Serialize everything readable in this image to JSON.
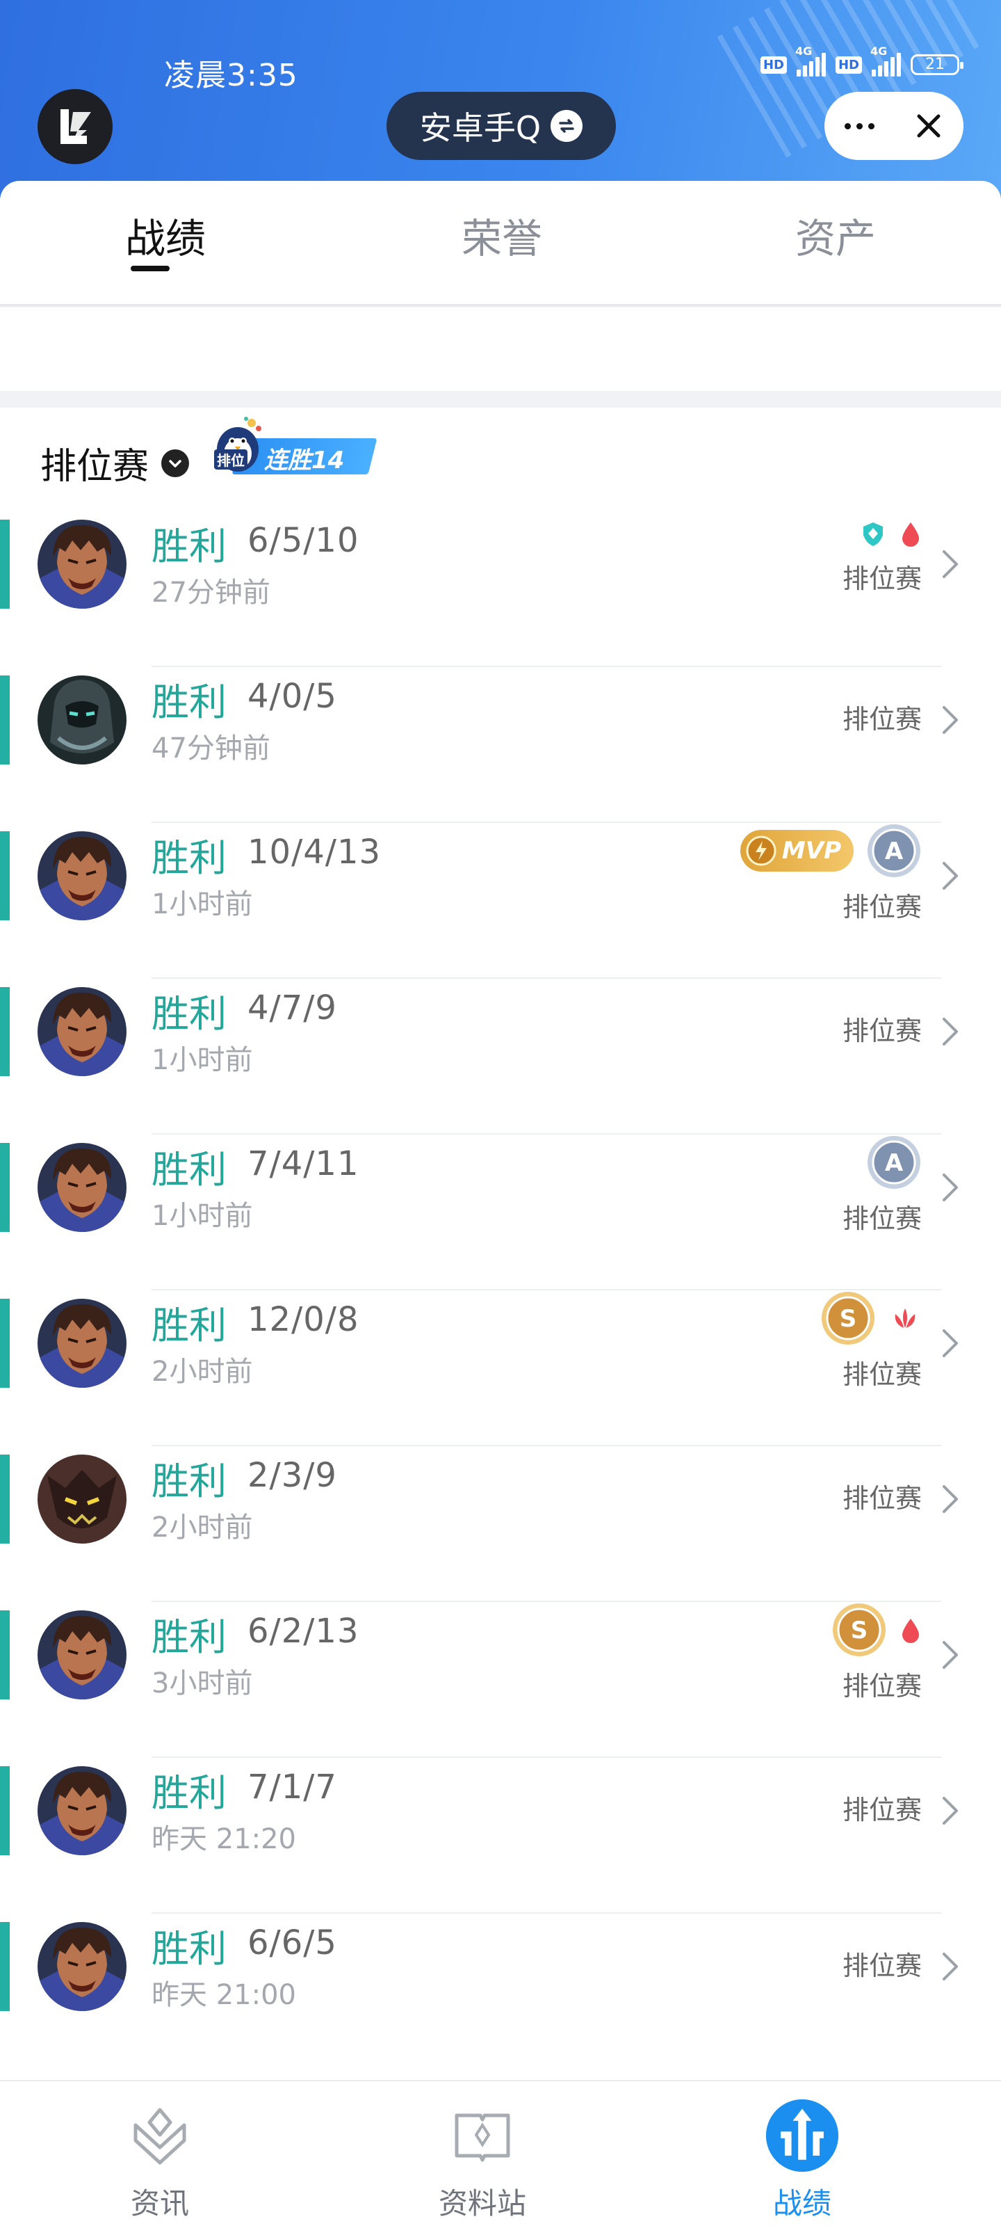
{
  "status_bar": {
    "time": "凌晨3:35",
    "hd1": "HD",
    "net1": "4G",
    "hd2": "HD",
    "net2": "4G",
    "battery": "21"
  },
  "header": {
    "account_switch_label": "安卓手Q",
    "icons": [
      "game-logo-icon",
      "switch-account-icon",
      "more-icon",
      "close-icon"
    ],
    "colors": {
      "gradient_start": "#2f6fe0",
      "gradient_end": "#5aa8f7",
      "switcher_bg": "#24344e"
    }
  },
  "tabs": [
    {
      "label": "战绩",
      "active": true
    },
    {
      "label": "荣誉",
      "active": false
    },
    {
      "label": "资产",
      "active": false
    }
  ],
  "section": {
    "title": "排位赛",
    "streak_badge": {
      "tag": "排位",
      "label": "连胜14"
    }
  },
  "matches": [
    {
      "result": "胜利",
      "kda": "6/5/10",
      "time": "27分钟前",
      "mode": "排位赛",
      "hero": "warrior",
      "badges": [
        "shield-icon",
        "blood-drop-icon"
      ]
    },
    {
      "result": "胜利",
      "kda": "4/0/5",
      "time": "47分钟前",
      "mode": "排位赛",
      "hero": "armored",
      "badges": []
    },
    {
      "result": "胜利",
      "kda": "10/4/13",
      "time": "1小时前",
      "mode": "排位赛",
      "hero": "warrior",
      "badges": [
        "mvp-badge",
        "grade-a-badge"
      ],
      "mvp_label": "MVP",
      "grade": "A"
    },
    {
      "result": "胜利",
      "kda": "4/7/9",
      "time": "1小时前",
      "mode": "排位赛",
      "hero": "warrior",
      "badges": []
    },
    {
      "result": "胜利",
      "kda": "7/4/11",
      "time": "1小时前",
      "mode": "排位赛",
      "hero": "warrior",
      "badges": [
        "grade-a-badge"
      ],
      "grade": "A"
    },
    {
      "result": "胜利",
      "kda": "12/0/8",
      "time": "2小时前",
      "mode": "排位赛",
      "hero": "warrior",
      "badges": [
        "grade-s-badge",
        "flame-icon"
      ],
      "grade": "S"
    },
    {
      "result": "胜利",
      "kda": "2/3/9",
      "time": "2小时前",
      "mode": "排位赛",
      "hero": "demon",
      "badges": []
    },
    {
      "result": "胜利",
      "kda": "6/2/13",
      "time": "3小时前",
      "mode": "排位赛",
      "hero": "warrior",
      "badges": [
        "grade-s-badge",
        "blood-drop-icon"
      ],
      "grade": "S"
    },
    {
      "result": "胜利",
      "kda": "7/1/7",
      "time": "昨天 21:20",
      "mode": "排位赛",
      "hero": "warrior",
      "badges": []
    },
    {
      "result": "胜利",
      "kda": "6/6/5",
      "time": "昨天 21:00",
      "mode": "排位赛",
      "hero": "warrior",
      "badges": []
    }
  ],
  "bottom_nav": [
    {
      "label": "资讯",
      "icon": "news-icon",
      "active": false
    },
    {
      "label": "资料站",
      "icon": "book-icon",
      "active": false
    },
    {
      "label": "战绩",
      "icon": "record-icon",
      "active": true
    }
  ],
  "colors": {
    "win": "#23a79a",
    "win_bar": "#23b0a2",
    "accent": "#1a8ff0",
    "muted": "#a4a8ae"
  }
}
